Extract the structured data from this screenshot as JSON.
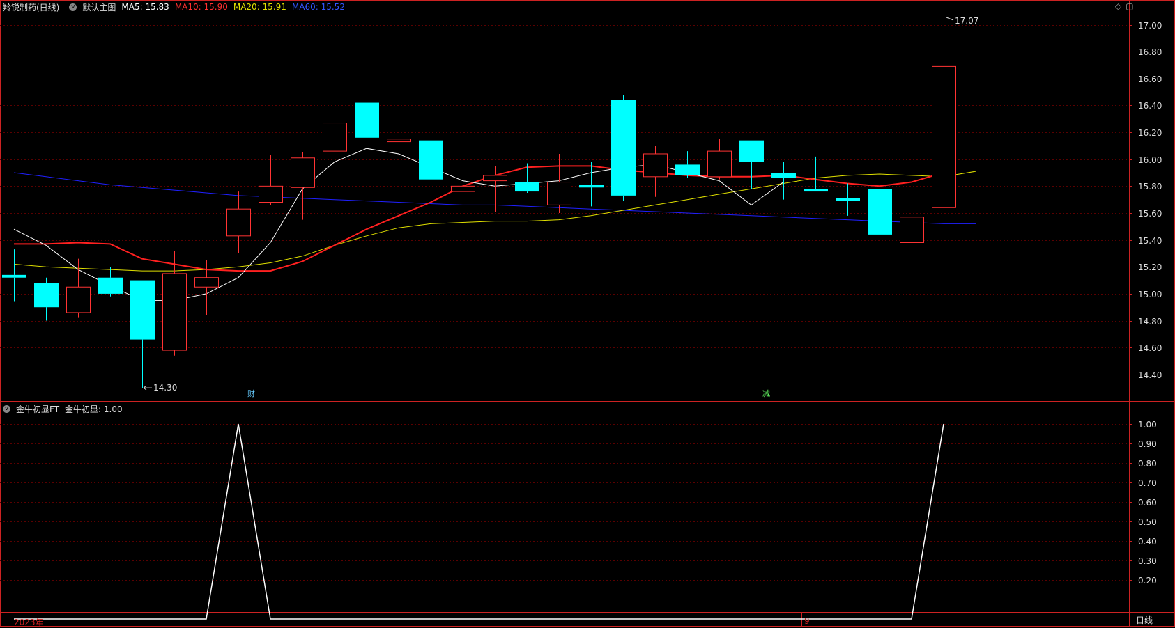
{
  "header": {
    "stock": "羚锐制药(日线)",
    "template": "默认主图",
    "ma5": "MA5: 15.83",
    "ma10": "MA10: 15.90",
    "ma20": "MA20: 15.91",
    "ma60": "MA60: 15.52"
  },
  "indicator_header": {
    "name": "金牛初显FT",
    "value": "金牛初显: 1.00"
  },
  "icons": [
    "diamond-icon",
    "window-icon",
    "circle-arrow-icon"
  ],
  "event_labels": {
    "cai": "财",
    "jian": "减"
  },
  "bottom": {
    "year": "2023年",
    "month": "9",
    "period": "日线"
  },
  "annotations": {
    "high": "17.07",
    "low": "14.30"
  },
  "colors": {
    "up": "#ff3333",
    "down": "#00ffff",
    "ma5": "#ffffff",
    "ma10": "#ff2020",
    "ma20": "#e0e000",
    "ma60": "#2020ff",
    "grid": "#5a0000",
    "axis": "#cc2222"
  },
  "chart_data": [
    {
      "type": "candlestick",
      "ylim": [
        14.2,
        17.2
      ],
      "yticks": [
        "17.00",
        "16.80",
        "16.60",
        "16.40",
        "16.20",
        "16.00",
        "15.80",
        "15.60",
        "15.40",
        "15.20",
        "15.00",
        "14.80",
        "14.60",
        "14.40"
      ],
      "candles": [
        {
          "o": 15.14,
          "h": 15.33,
          "l": 14.94,
          "c": 15.12
        },
        {
          "o": 15.08,
          "h": 15.12,
          "l": 14.8,
          "c": 14.9
        },
        {
          "o": 14.86,
          "h": 15.26,
          "l": 14.82,
          "c": 15.05
        },
        {
          "o": 15.12,
          "h": 15.2,
          "l": 14.98,
          "c": 15.0
        },
        {
          "o": 15.1,
          "h": 15.1,
          "l": 14.3,
          "c": 14.66
        },
        {
          "o": 14.58,
          "h": 15.32,
          "l": 14.54,
          "c": 15.15
        },
        {
          "o": 15.05,
          "h": 15.25,
          "l": 14.84,
          "c": 15.12
        },
        {
          "o": 15.43,
          "h": 15.76,
          "l": 15.3,
          "c": 15.63
        },
        {
          "o": 15.68,
          "h": 16.03,
          "l": 15.66,
          "c": 15.8
        },
        {
          "o": 15.79,
          "h": 16.05,
          "l": 15.55,
          "c": 16.01
        },
        {
          "o": 16.06,
          "h": 16.28,
          "l": 15.9,
          "c": 16.27
        },
        {
          "o": 16.42,
          "h": 16.43,
          "l": 16.1,
          "c": 16.16
        },
        {
          "o": 16.13,
          "h": 16.23,
          "l": 15.99,
          "c": 16.15
        },
        {
          "o": 16.14,
          "h": 16.15,
          "l": 15.8,
          "c": 15.85
        },
        {
          "o": 15.76,
          "h": 15.93,
          "l": 15.62,
          "c": 15.8
        },
        {
          "o": 15.84,
          "h": 15.95,
          "l": 15.61,
          "c": 15.88
        },
        {
          "o": 15.83,
          "h": 15.97,
          "l": 15.75,
          "c": 15.76
        },
        {
          "o": 15.66,
          "h": 16.04,
          "l": 15.6,
          "c": 15.83
        },
        {
          "o": 15.81,
          "h": 15.98,
          "l": 15.65,
          "c": 15.79
        },
        {
          "o": 16.44,
          "h": 16.48,
          "l": 15.69,
          "c": 15.73
        },
        {
          "o": 15.87,
          "h": 16.1,
          "l": 15.72,
          "c": 16.04
        },
        {
          "o": 15.96,
          "h": 16.06,
          "l": 15.86,
          "c": 15.88
        },
        {
          "o": 15.87,
          "h": 16.15,
          "l": 15.85,
          "c": 16.06
        },
        {
          "o": 16.14,
          "h": 16.14,
          "l": 15.78,
          "c": 15.98
        },
        {
          "o": 15.9,
          "h": 15.98,
          "l": 15.7,
          "c": 15.86
        },
        {
          "o": 15.78,
          "h": 16.02,
          "l": 15.76,
          "c": 15.76
        },
        {
          "o": 15.71,
          "h": 15.82,
          "l": 15.58,
          "c": 15.69
        },
        {
          "o": 15.78,
          "h": 15.79,
          "l": 15.44,
          "c": 15.44
        },
        {
          "o": 15.38,
          "h": 15.61,
          "l": 15.37,
          "c": 15.57
        },
        {
          "o": 15.64,
          "h": 17.07,
          "l": 15.57,
          "c": 16.69
        }
      ],
      "ma5": [
        15.48,
        15.36,
        15.18,
        15.06,
        14.95,
        14.95,
        15.0,
        15.12,
        15.38,
        15.78,
        15.98,
        16.08,
        16.04,
        15.94,
        15.84,
        15.8,
        15.82,
        15.84,
        15.9,
        15.94,
        15.96,
        15.9,
        15.84,
        15.66,
        15.83
      ],
      "ma10": [
        15.37,
        15.37,
        15.38,
        15.37,
        15.26,
        15.22,
        15.18,
        15.17,
        15.17,
        15.24,
        15.36,
        15.48,
        15.58,
        15.68,
        15.8,
        15.88,
        15.94,
        15.95,
        15.95,
        15.92,
        15.9,
        15.88,
        15.87,
        15.87,
        15.88,
        15.85,
        15.82,
        15.8,
        15.83,
        15.9
      ],
      "ma20": [
        15.22,
        15.2,
        15.19,
        15.18,
        15.17,
        15.17,
        15.18,
        15.2,
        15.23,
        15.28,
        15.36,
        15.43,
        15.49,
        15.52,
        15.53,
        15.54,
        15.54,
        15.55,
        15.58,
        15.62,
        15.66,
        15.7,
        15.74,
        15.78,
        15.82,
        15.86,
        15.88,
        15.89,
        15.88,
        15.87,
        15.91
      ],
      "ma60": [
        15.9,
        15.87,
        15.84,
        15.81,
        15.79,
        15.77,
        15.75,
        15.73,
        15.72,
        15.71,
        15.7,
        15.69,
        15.68,
        15.67,
        15.66,
        15.66,
        15.65,
        15.64,
        15.63,
        15.62,
        15.61,
        15.6,
        15.59,
        15.58,
        15.57,
        15.56,
        15.55,
        15.54,
        15.53,
        15.52,
        15.52
      ]
    },
    {
      "type": "line",
      "name": "金牛初显",
      "ylim": [
        0,
        1.05
      ],
      "yticks": [
        "1.00",
        "0.90",
        "0.80",
        "0.70",
        "0.60",
        "0.50",
        "0.40",
        "0.30",
        "0.20"
      ],
      "values": [
        0,
        0,
        0,
        0,
        0,
        0,
        0,
        1,
        0,
        0,
        0,
        0,
        0,
        0,
        0,
        0,
        0,
        0,
        0,
        0,
        0,
        0,
        0,
        0,
        0,
        0,
        0,
        0,
        0,
        1
      ]
    }
  ]
}
